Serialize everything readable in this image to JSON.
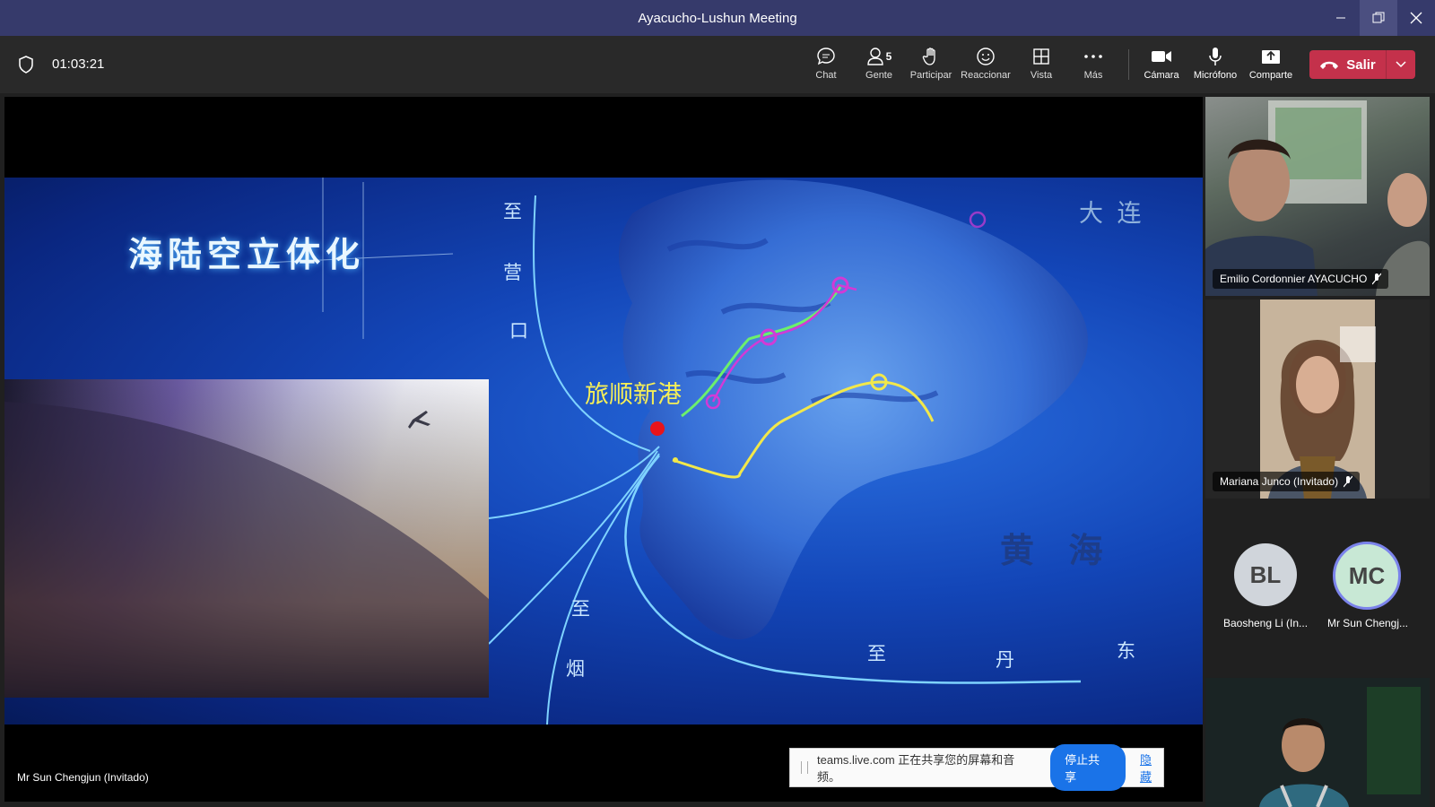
{
  "window": {
    "title": "Ayacucho-Lushun Meeting"
  },
  "toolbar": {
    "timer": "01:03:21",
    "chat": "Chat",
    "people": "Gente",
    "people_count": "5",
    "raise": "Participar",
    "react": "Reaccionar",
    "view": "Vista",
    "more": "Más",
    "camera": "Cámara",
    "mic": "Micrófono",
    "share": "Comparte",
    "leave": "Salir"
  },
  "slide": {
    "headline": "海陆空立体化",
    "port": "旅顺新港",
    "to_yingkou": [
      "至",
      "营",
      "口"
    ],
    "dalian": "大 连",
    "yellow_sea": "黄 海",
    "to_yantai": [
      "至",
      "烟"
    ],
    "to_dandong": [
      "至",
      "丹",
      "东"
    ]
  },
  "presenter_label": "Mr Sun Chengjun (Invitado)",
  "sharebar": {
    "message": "teams.live.com 正在共享您的屏幕和音频。",
    "stop": "停止共享",
    "hide": "隐藏"
  },
  "participants": [
    {
      "name": "Emilio Cordonnier AYACUCHO"
    },
    {
      "name": "Mariana Junco (Invitado)"
    },
    {
      "initials": "BL",
      "name": "Baosheng Li (In..."
    },
    {
      "initials": "MC",
      "name": "Mr Sun Chengj..."
    }
  ],
  "colors": {
    "titlebar": "#363a6b",
    "leave": "#c4314b",
    "route_yellow": "#f2e84a",
    "route_magenta": "#d23ad6",
    "route_green": "#6cf06c"
  }
}
